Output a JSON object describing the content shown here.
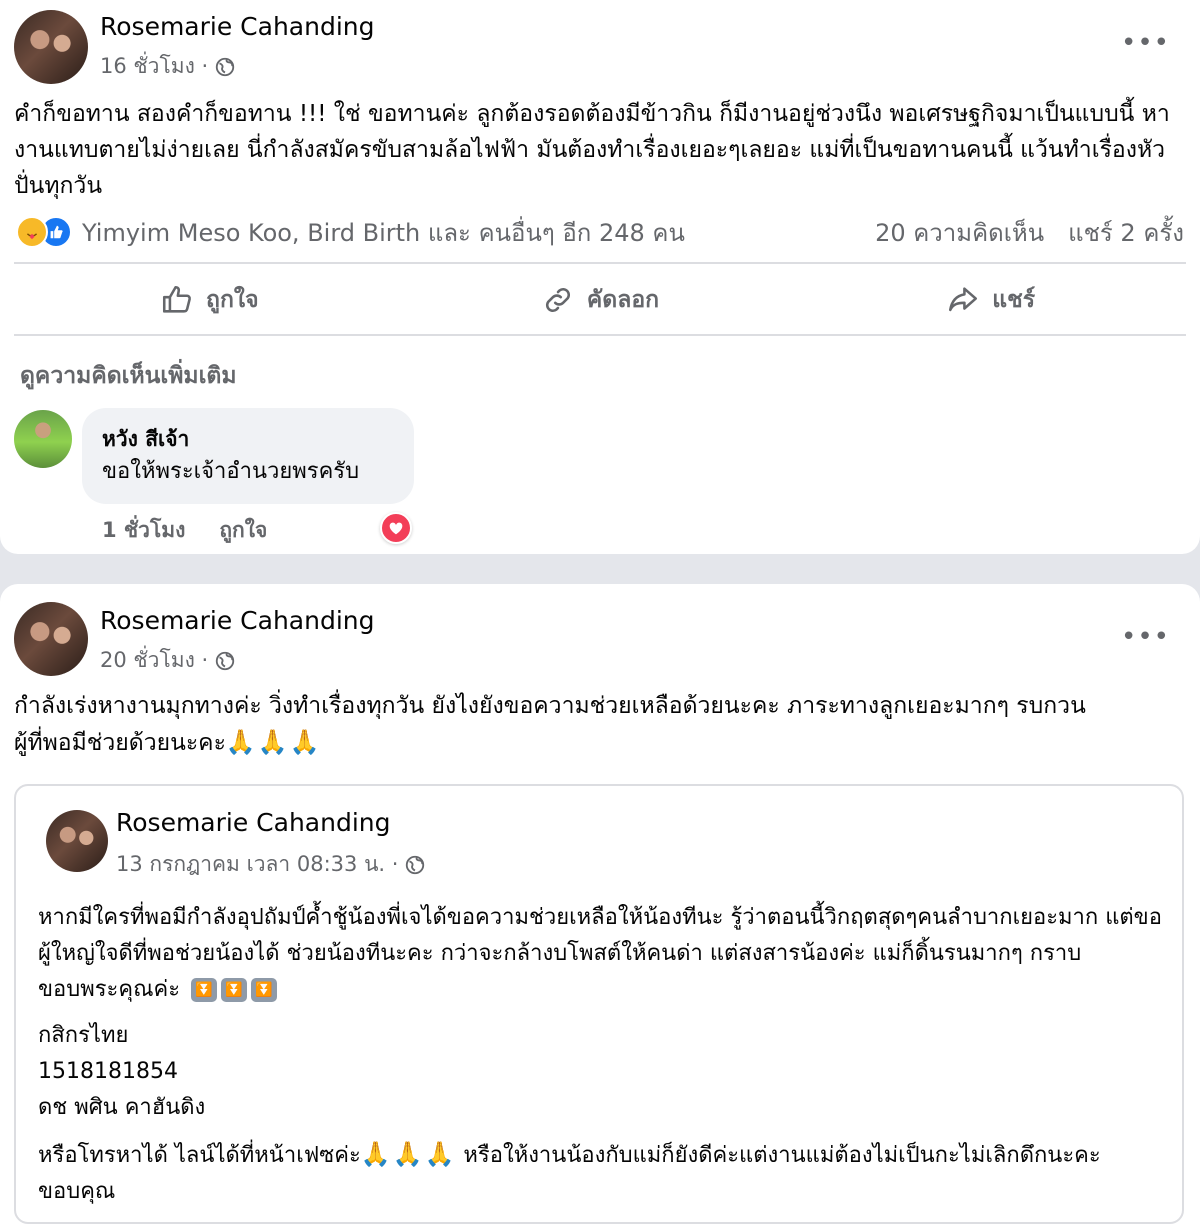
{
  "post1": {
    "author": "Rosemarie Cahanding",
    "time": "16 ชั่วโมง ·",
    "text": "คำก็ขอทาน สองคำก็ขอทาน !!! ใช่ ขอทานค่ะ ลูกต้องรอดต้องมีข้าวกิน ก็มีงานอยู่ช่วงนึง พอเศรษฐกิจมาเป็นแบบนี้ หางานแทบตายไม่ง่ายเลย นี่กำลังสมัครขับสามล้อไฟฟ้า  มันต้องทำเรื่องเยอะๆเลยอะ แม่ที่เป็นขอทานคนนี้ แว้นทำเรื่องหัวปั่นทุกวัน",
    "reactions_text": "Yimyim Meso Koo, Bird Birth และ คนอื่นๆ อีก 248 คน",
    "comments_count": "20 ความคิดเห็น",
    "shares_count": "แชร์ 2 ครั้ง",
    "actions": {
      "like": "ถูกใจ",
      "copy": "คัดลอก",
      "share": "แชร์"
    },
    "more_comments": "ดูความคิดเห็นเพิ่มเติม",
    "comment": {
      "name": "หวัง สีเจ้า",
      "text": "ขอให้พระเจ้าอำนวยพรครับ",
      "time": "1 ชั่วโมง",
      "like": "ถูกใจ"
    }
  },
  "post2": {
    "author": "Rosemarie Cahanding",
    "time": "20 ชั่วโมง ·",
    "text_line1": "กำลังเร่งหางานมุกทางค่ะ วิ่งทำเรื่องทุกวัน ยังไงยังขอความช่วยเหลือด้วยนะคะ ภาระทางลูกเยอะมากๆ รบกวน",
    "text_line2": "ผู้ที่พอมีช่วยด้วยนะคะ",
    "pray_emoji": "🙏🙏🙏",
    "shared": {
      "author": "Rosemarie Cahanding",
      "time": "13 กรกฎาคม เวลา 08:33 น. ·",
      "para1": "หากมีใครที่พอมีกำลังอุปถัมป์ค้ำชู้น้องพี่เจได้ขอความช่วยเหลือให้น้องทีนะ รู้ว่าตอนนี้วิกฤตสุดๆคนลำบากเยอะมาก แต่ขอผู้ใหญ่ใจดีที่พอช่วยน้องได้ ช่วยน้องทีนะคะ กว่าจะกล้างบโพสต์ให้คนด่า แต่สงสารน้องค่ะ แม่ก็ดิ้นรนมากๆ กราบขอบพระคุณค่ะ",
      "arrows": [
        "⏬",
        "⏬",
        "⏬"
      ],
      "bank": "กสิกรไทย",
      "account": "1518181854",
      "account_name": "ดช พศิน คาฮันดิง",
      "para2_a": "หรือโทรหาได้ ไลน์ได้ที่หน้าเฟซค่ะ",
      "para2_emoji": "🙏🙏🙏",
      "para2_b": " หรือให้งานน้องกับแม่ก็ยังดีค่ะแต่งานแม่ต้องไม่เป็นกะไม่เลิกดึกนะคะ ขอบคุณ"
    }
  },
  "colors": {
    "bg": "#e4e6eb",
    "card": "#ffffff",
    "secondary_text": "#65676b",
    "like_blue": "#1877f2",
    "love_red": "#f33e58"
  }
}
